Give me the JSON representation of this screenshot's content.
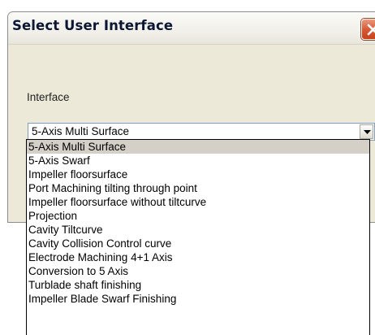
{
  "dialog": {
    "title": "Select User Interface"
  },
  "form": {
    "interface_label": "Interface",
    "selected_value": "5-Axis Multi Surface"
  },
  "dropdown": {
    "selected_index": 0,
    "options": [
      "5-Axis Multi Surface",
      "5-Axis Swarf",
      "Impeller floorsurface",
      "Port Machining tilting through point",
      "Impeller floorsurface without tiltcurve",
      "Projection",
      "Cavity Tiltcurve",
      "Cavity Collision Control curve",
      "Electrode Machining 4+1 Axis",
      "Conversion to 5 Axis",
      "Turblade shaft finishing",
      "Impeller Blade Swarf Finishing"
    ]
  },
  "icons": {
    "close": "close-icon",
    "combo_arrow": "chevron-down-icon"
  },
  "colors": {
    "dialog_bg": "#ece9d8",
    "close_button": "#d75a38",
    "list_selection": "#d4d0c8",
    "combo_border": "#7f9db9"
  }
}
